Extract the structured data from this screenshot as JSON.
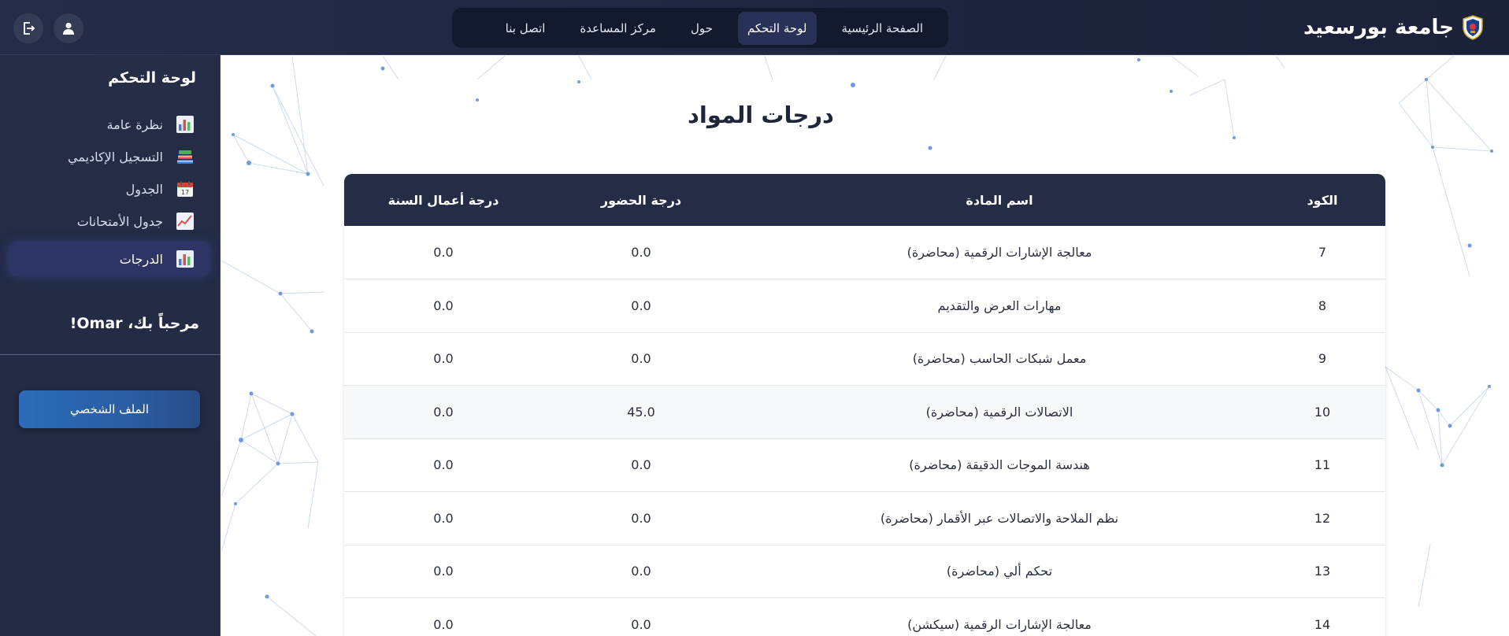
{
  "brand": {
    "name": "جامعة بورسعيد",
    "logo_icon": "university-shield-logo"
  },
  "nav": {
    "items": [
      {
        "label": "الصفحة الرئيسية",
        "active": false
      },
      {
        "label": "لوحة التحكم",
        "active": true
      },
      {
        "label": "حول",
        "active": false
      },
      {
        "label": "مركز المساعدة",
        "active": false
      },
      {
        "label": "اتصل بنا",
        "active": false
      }
    ]
  },
  "topbar_icons": {
    "user": "user-icon",
    "logout": "logout-icon"
  },
  "sidebar": {
    "title": "لوحة التحكم",
    "items": [
      {
        "label": "نظرة عامة",
        "icon": "bar-chart-icon"
      },
      {
        "label": "التسجيل الإكاديمي",
        "icon": "books-icon"
      },
      {
        "label": "الجدول",
        "icon": "calendar-icon"
      },
      {
        "label": "جدول الأمتحانات",
        "icon": "trend-chart-icon"
      },
      {
        "label": "الدرجات",
        "icon": "bar-chart-icon",
        "active": true
      }
    ],
    "welcome": "مرحباً بك، Omar!",
    "profile_button": "الملف الشخصي"
  },
  "main": {
    "title": "درجات المواد",
    "table": {
      "headers": [
        "الكود",
        "اسم المادة",
        "درجة الحضور",
        "درجة أعمال السنة"
      ],
      "rows": [
        [
          "7",
          "معالجة الإشارات الرقمية (محاضرة)",
          "0.0",
          "0.0"
        ],
        [
          "8",
          "مهارات العرض والتقديم",
          "0.0",
          "0.0"
        ],
        [
          "9",
          "معمل شبكات الحاسب (محاضرة)",
          "0.0",
          "0.0"
        ],
        [
          "10",
          "الاتصالات الرقمية (محاضرة)",
          "45.0",
          "0.0"
        ],
        [
          "11",
          "هندسة الموجات الدقيقة (محاضرة)",
          "0.0",
          "0.0"
        ],
        [
          "12",
          "نظم الملاحة والاتصالات عبر الأقمار (محاضرة)",
          "0.0",
          "0.0"
        ],
        [
          "13",
          "تحكم ألي (محاضرة)",
          "0.0",
          "0.0"
        ],
        [
          "14",
          "معالجة الإشارات الرقمية (سيكشن)",
          "0.0",
          "0.0"
        ]
      ]
    }
  },
  "colors": {
    "topbar": "#1f2640",
    "sidebar": "#232b45",
    "table_header": "#252c45",
    "accent": "#2a6db8"
  }
}
